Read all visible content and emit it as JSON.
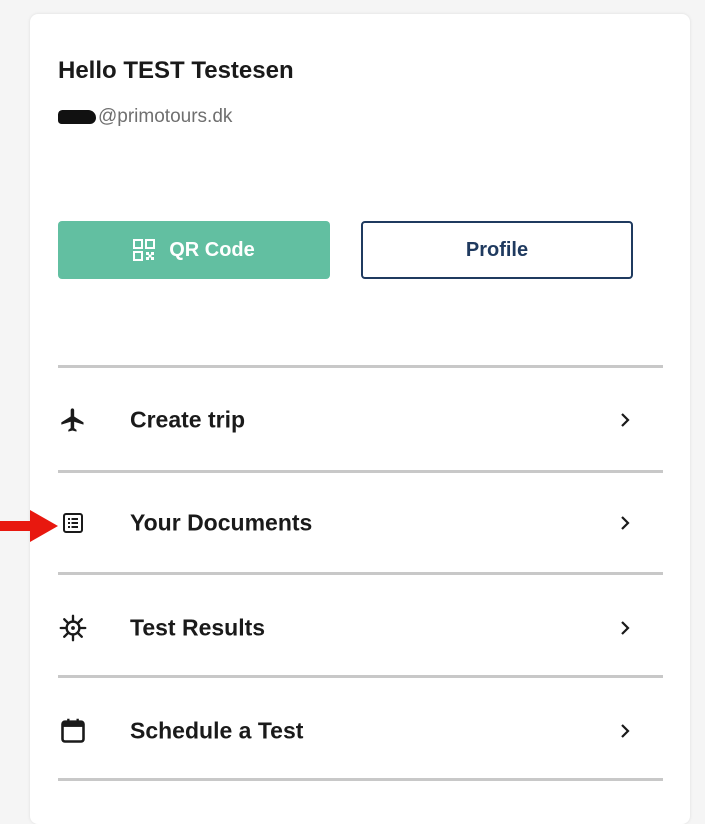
{
  "user": {
    "greeting": "Hello TEST Testesen",
    "email_visible": "@primotours.dk"
  },
  "actions": {
    "qr_label": "QR Code",
    "profile_label": "Profile"
  },
  "menu": [
    {
      "label": "Create trip",
      "icon": "airplane-icon"
    },
    {
      "label": "Your Documents",
      "icon": "document-list-icon"
    },
    {
      "label": "Test Results",
      "icon": "virus-icon"
    },
    {
      "label": "Schedule a Test",
      "icon": "calendar-icon"
    }
  ],
  "colors": {
    "accent": "#62bfa1",
    "navy": "#1f3a5f",
    "annotation_arrow": "#e8180f"
  }
}
